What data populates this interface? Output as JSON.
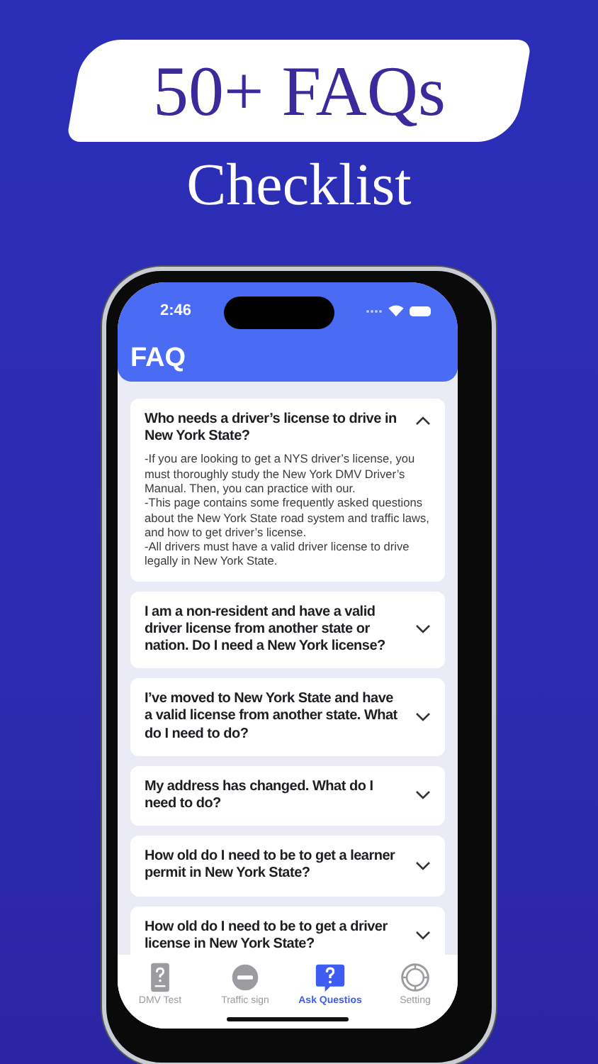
{
  "promo": {
    "headline": "50+ FAQs",
    "subtitle": "Checklist"
  },
  "status_bar": {
    "time": "2:46"
  },
  "header": {
    "title": "FAQ"
  },
  "faq": [
    {
      "question": "Who needs a driver’s license to drive in New York State?",
      "expanded": true,
      "answer": [
        "-If you are looking to get a NYS driver’s license, you must thoroughly study the New York DMV Driver’s Manual. Then, you can practice with our.",
        "-This page contains some frequently asked questions about the New York State road system and traffic laws, and how to get driver’s license.",
        "-All drivers must have a valid driver license to drive legally in New York State."
      ]
    },
    {
      "question": "I am a non-resident and have a valid driver license from another state or nation. Do I need a New York license?",
      "expanded": false
    },
    {
      "question": "I’ve moved to New York State and have a valid license from another state. What do I need to do?",
      "expanded": false
    },
    {
      "question": "My address has changed. What do I need to do?",
      "expanded": false
    },
    {
      "question": "How old do I need to be to get a learner permit in New York State?",
      "expanded": false
    },
    {
      "question": "How old do I need to be to get a driver license in New York State?",
      "expanded": false
    }
  ],
  "tab_bar": [
    {
      "label": "DMV Test",
      "kind": "test",
      "selected": false
    },
    {
      "label": "Traffic sign",
      "kind": "sign",
      "selected": false
    },
    {
      "label": "Ask Questios",
      "kind": "question",
      "selected": true
    },
    {
      "label": "Setting",
      "kind": "settings",
      "selected": false
    }
  ]
}
